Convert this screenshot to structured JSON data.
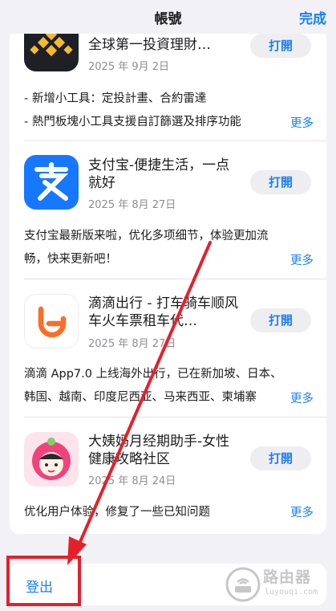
{
  "header": {
    "title": "帳號",
    "done_label": "完成"
  },
  "apps": [
    {
      "name": "全球第一投資理財…",
      "date": "2025 年 9月 2日",
      "open_label": "打開",
      "notes": [
        "- 新增小工具：定投計畫、合約雷達",
        "- 熱門板塊小工具支援自訂篩選及排序功能"
      ],
      "more_label": "更多",
      "icon": "binance-icon"
    },
    {
      "name": "支付宝-便捷生活，一点就好",
      "date": "2025 年 8月 27日",
      "open_label": "打開",
      "notes": [
        "支付宝最新版来啦，优化多项细节，体验更加流",
        "畅，快来更新吧！"
      ],
      "more_label": "更多",
      "icon": "alipay-icon",
      "icon_color": "#1677ff"
    },
    {
      "name": "滴滴出行 - 打车骑车顺风车火车票租车代…",
      "date": "2025 年 8月 27日",
      "open_label": "打開",
      "notes": [
        "滴滴 App7.0 上线海外出行，已在新加坡、日本、",
        "韩国、越南、印度尼西亚、马来西亚、柬埔寨"
      ],
      "more_label": "更多",
      "icon": "didi-icon",
      "icon_color": "#fc6d26"
    },
    {
      "name": "大姨妈月经期助手-女性健康攻略社区",
      "date": "2025 年 8月 24日",
      "open_label": "打開",
      "notes": [
        "优化用户体验，修复了一些已知问题"
      ],
      "more_label": "更多",
      "icon": "dayima-icon",
      "icon_color": "#f0437e"
    }
  ],
  "signout_label": "登出",
  "watermark": {
    "text": "路由器",
    "sub": "luyouqi.com"
  },
  "annotation_color": "#e6202b"
}
